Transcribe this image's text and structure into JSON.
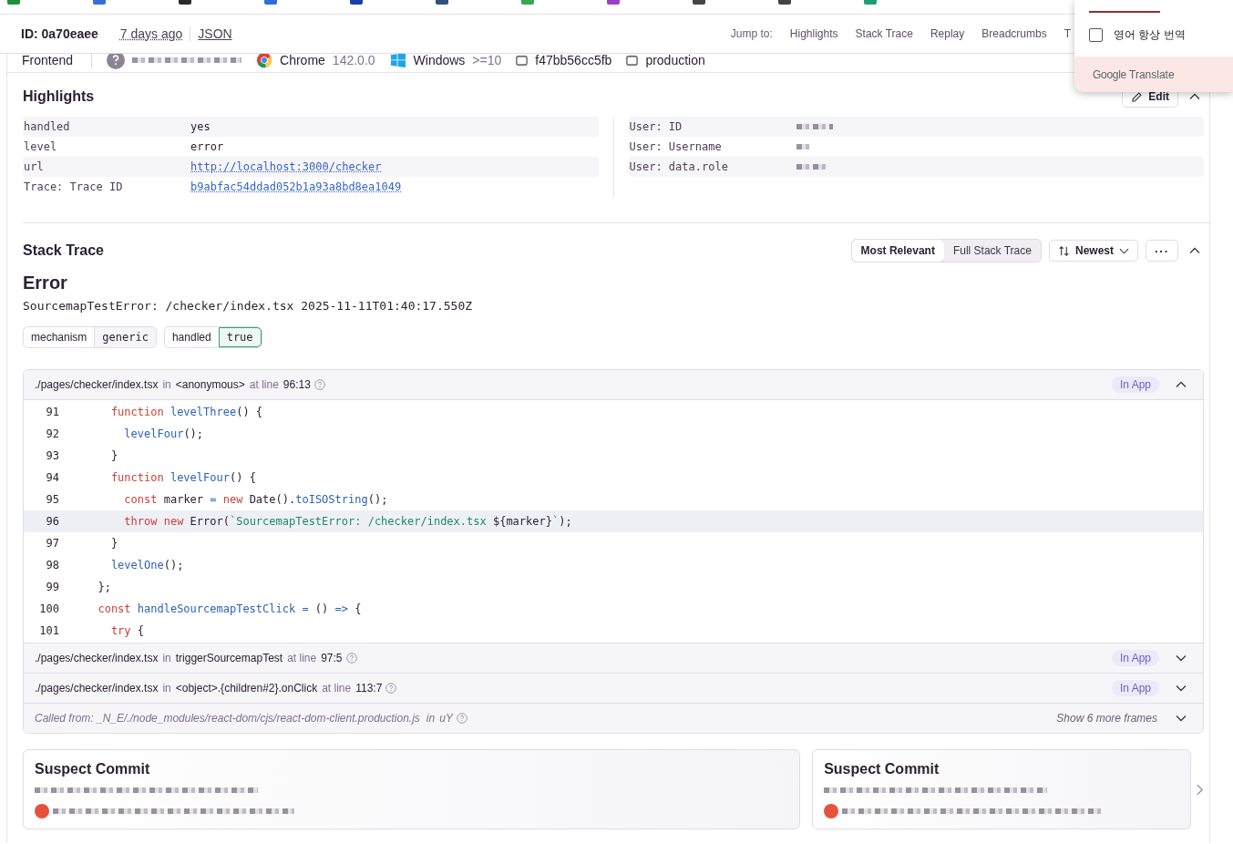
{
  "bookmarks_bar": [
    {
      "color": "#1e8e3e"
    },
    {
      "color": "#3b6fd8"
    },
    {
      "color": "#2a2a2a"
    },
    {
      "color": "#2f6fd6"
    },
    {
      "color": "#1a3fa6"
    },
    {
      "color": "#31507a"
    },
    {
      "color": "#34a853"
    },
    {
      "color": "#9b3fc9"
    },
    {
      "color": "#444444"
    },
    {
      "color": "#444444"
    },
    {
      "color": "#1e9e6e"
    }
  ],
  "header": {
    "event_id": "ID: 0a70eaee",
    "time": "7 days ago",
    "json_link": "JSON",
    "jump_label": "Jump to:",
    "jump_links": [
      "Highlights",
      "Stack Trace",
      "Replay",
      "Breadcrumbs",
      "T"
    ]
  },
  "context_tags": [
    {
      "kind": "text",
      "label": "Frontend"
    },
    {
      "kind": "user"
    },
    {
      "kind": "browser",
      "label": "Chrome",
      "version": "142.0.0"
    },
    {
      "kind": "os",
      "label": "Windows",
      "version": ">=10"
    },
    {
      "kind": "box",
      "label": "f47bb56cc5fb"
    },
    {
      "kind": "box",
      "label": "production"
    }
  ],
  "translate_popup": {
    "always_translate": {
      "label": "영어 항상 번역",
      "checked": false
    },
    "brand": "Google",
    "product": "Translate"
  },
  "highlights": {
    "title": "Highlights",
    "edit_button": "Edit",
    "expanded": true,
    "left_rows": [
      {
        "key": "handled",
        "value": "yes",
        "kind": "text"
      },
      {
        "key": "level",
        "value": "error",
        "kind": "text"
      },
      {
        "key": "url",
        "value": "http://localhost:3000/checker",
        "kind": "link"
      },
      {
        "key": "Trace: Trace ID",
        "value": "b9abfac54ddad052b1a93a8bd8ea1049",
        "kind": "link"
      }
    ],
    "right_rows": [
      {
        "key": "User: ID",
        "kind": "redacted"
      },
      {
        "key": "User: Username",
        "kind": "redacted"
      },
      {
        "key": "User: data.role",
        "kind": "redacted"
      }
    ]
  },
  "stack_trace": {
    "title": "Stack Trace",
    "expanded": true,
    "view_toggle": [
      {
        "label": "Most Relevant",
        "selected": true
      },
      {
        "label": "Full Stack Trace",
        "selected": false
      }
    ],
    "sort_button": "Newest",
    "more_button": "···",
    "error_type": "Error",
    "error_message": "SourcemapTestError: /checker/index.tsx 2025-11-11T01:40:17.550Z",
    "tags": [
      {
        "key": "mechanism",
        "value": "generic",
        "highlighted": false
      },
      {
        "key": "handled",
        "value": "true",
        "highlighted": true
      }
    ],
    "frames": [
      {
        "file": "./pages/checker/index.tsx",
        "in_word": "in",
        "function": "<anonymous>",
        "at_word": "at line",
        "line": "96:13",
        "badge": "In App",
        "expanded": true,
        "code": [
          {
            "number": "91",
            "highlighted": false,
            "tokens": [
              {
                "kind": "kw",
                "text": "    function "
              },
              {
                "kind": "fn",
                "text": "levelThree"
              },
              {
                "kind": "p",
                "text": "() {"
              }
            ]
          },
          {
            "number": "92",
            "highlighted": false,
            "tokens": [
              {
                "kind": "fn",
                "text": "      levelFour"
              },
              {
                "kind": "p",
                "text": "();"
              }
            ]
          },
          {
            "number": "93",
            "highlighted": false,
            "tokens": [
              {
                "kind": "p",
                "text": "    }"
              }
            ]
          },
          {
            "number": "94",
            "highlighted": false,
            "tokens": [
              {
                "kind": "kw",
                "text": "    function "
              },
              {
                "kind": "fn",
                "text": "levelFour"
              },
              {
                "kind": "p",
                "text": "() {"
              }
            ]
          },
          {
            "number": "95",
            "highlighted": false,
            "tokens": [
              {
                "kind": "kw",
                "text": "      const"
              },
              {
                "kind": "p",
                "text": " marker "
              },
              {
                "kind": "op",
                "text": "="
              },
              {
                "kind": "kw",
                "text": " new"
              },
              {
                "kind": "p",
                "text": " Date()."
              },
              {
                "kind": "fn",
                "text": "toISOString"
              },
              {
                "kind": "p",
                "text": "();"
              }
            ]
          },
          {
            "number": "96",
            "highlighted": true,
            "tokens": [
              {
                "kind": "kw",
                "text": "      throw new"
              },
              {
                "kind": "p",
                "text": " Error("
              },
              {
                "kind": "str",
                "text": "`SourcemapTestError: /checker/index.tsx "
              },
              {
                "kind": "p",
                "text": "${marker}"
              },
              {
                "kind": "str",
                "text": "`"
              },
              {
                "kind": "p",
                "text": ");"
              }
            ]
          },
          {
            "number": "97",
            "highlighted": false,
            "tokens": [
              {
                "kind": "p",
                "text": "    }"
              }
            ]
          },
          {
            "number": "98",
            "highlighted": false,
            "tokens": [
              {
                "kind": "fn",
                "text": "    levelOne"
              },
              {
                "kind": "p",
                "text": "();"
              }
            ]
          },
          {
            "number": "99",
            "highlighted": false,
            "tokens": [
              {
                "kind": "p",
                "text": "  };"
              }
            ]
          },
          {
            "number": "100",
            "highlighted": false,
            "tokens": [
              {
                "kind": "kw",
                "text": "  const "
              },
              {
                "kind": "fn",
                "text": "handleSourcemapTestClick"
              },
              {
                "kind": "op",
                "text": " ="
              },
              {
                "kind": "p",
                "text": " () "
              },
              {
                "kind": "op",
                "text": "=>"
              },
              {
                "kind": "p",
                "text": " {"
              }
            ]
          },
          {
            "number": "101",
            "highlighted": false,
            "tokens": [
              {
                "kind": "kw",
                "text": "    try"
              },
              {
                "kind": "p",
                "text": " {"
              }
            ]
          }
        ]
      },
      {
        "file": "./pages/checker/index.tsx",
        "in_word": "in",
        "function": "triggerSourcemapTest",
        "at_word": "at line",
        "line": "97:5",
        "badge": "In App",
        "expanded": false
      },
      {
        "file": "./pages/checker/index.tsx",
        "in_word": "in",
        "function": "<object>.{children#2}.onClick",
        "at_word": "at line",
        "line": "113:7",
        "badge": "In App",
        "expanded": false
      }
    ],
    "called_from": {
      "text": "Called from: _N_E/./node_modules/react-dom/cjs/react-dom-client.production.js",
      "in_word": "in",
      "function": "uY",
      "more": "Show 6 more frames"
    }
  },
  "suspect_commits": [
    {
      "title": "Suspect Commit"
    },
    {
      "title": "Suspect Commit"
    }
  ]
}
